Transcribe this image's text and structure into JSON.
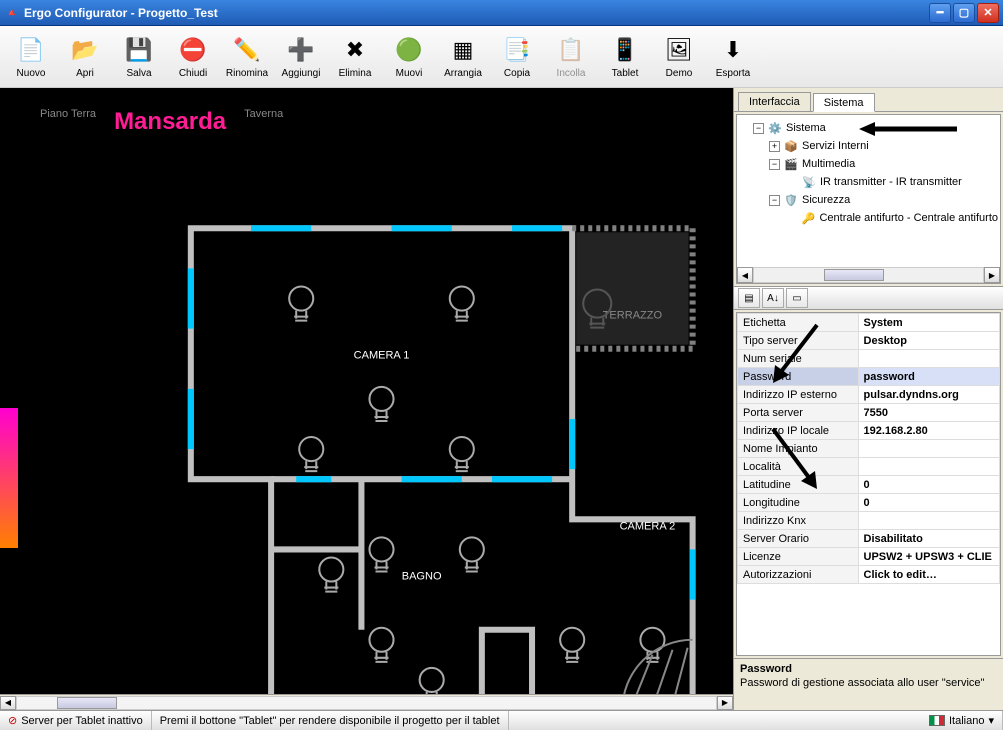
{
  "window": {
    "title": "Ergo Configurator - Progetto_Test"
  },
  "toolbar": [
    {
      "id": "nuovo",
      "label": "Nuovo",
      "icon": "📄",
      "enabled": true
    },
    {
      "id": "apri",
      "label": "Apri",
      "icon": "📂",
      "enabled": true
    },
    {
      "id": "salva",
      "label": "Salva",
      "icon": "💾",
      "enabled": true
    },
    {
      "id": "chiudi",
      "label": "Chiudi",
      "icon": "⛔",
      "enabled": true
    },
    {
      "id": "rinomina",
      "label": "Rinomina",
      "icon": "✏️",
      "enabled": true
    },
    {
      "id": "aggiungi",
      "label": "Aggiungi",
      "icon": "➕",
      "enabled": true
    },
    {
      "id": "elimina",
      "label": "Elimina",
      "icon": "✖",
      "enabled": true
    },
    {
      "id": "muovi",
      "label": "Muovi",
      "icon": "🟢",
      "enabled": true
    },
    {
      "id": "arrangia",
      "label": "Arrangia",
      "icon": "▦",
      "enabled": true
    },
    {
      "id": "copia",
      "label": "Copia",
      "icon": "📑",
      "enabled": true
    },
    {
      "id": "incolla",
      "label": "Incolla",
      "icon": "📋",
      "enabled": false
    },
    {
      "id": "tablet",
      "label": "Tablet",
      "icon": "📱",
      "enabled": true
    },
    {
      "id": "demo",
      "label": "Demo",
      "icon": "🖼",
      "enabled": true
    },
    {
      "id": "esporta",
      "label": "Esporta",
      "icon": "⬇",
      "enabled": true
    }
  ],
  "floors": [
    {
      "label": "Piano Terra",
      "active": false
    },
    {
      "label": "Mansarda",
      "active": true
    },
    {
      "label": "Taverna",
      "active": false
    }
  ],
  "rooms": {
    "camera1": "CAMERA 1",
    "camera2": "CAMERA 2",
    "bagno": "BAGNO",
    "terrazzo": "TERRAZZO"
  },
  "sideTabs": [
    {
      "label": "Interfaccia",
      "active": false
    },
    {
      "label": "Sistema",
      "active": true
    }
  ],
  "tree": {
    "root": {
      "label": "Sistema"
    },
    "servizi": {
      "label": "Servizi Interni"
    },
    "multimedia": {
      "label": "Multimedia"
    },
    "ir": {
      "label": "IR transmitter - IR transmitter"
    },
    "sicurezza": {
      "label": "Sicurezza"
    },
    "centrale": {
      "label": "Centrale antifurto - Centrale antifurto"
    }
  },
  "properties": [
    {
      "name": "Etichetta",
      "value": "System"
    },
    {
      "name": "Tipo server",
      "value": "Desktop"
    },
    {
      "name": "Num seriale",
      "value": ""
    },
    {
      "name": "Password",
      "value": "password",
      "selected": true
    },
    {
      "name": "Indirizzo IP esterno",
      "value": "pulsar.dyndns.org"
    },
    {
      "name": "Porta server",
      "value": "7550"
    },
    {
      "name": "Indirizzo IP locale",
      "value": "192.168.2.80"
    },
    {
      "name": "Nome Impianto",
      "value": ""
    },
    {
      "name": "Località",
      "value": ""
    },
    {
      "name": "Latitudine",
      "value": "0"
    },
    {
      "name": "Longitudine",
      "value": "0"
    },
    {
      "name": "Indirizzo Knx",
      "value": ""
    },
    {
      "name": "Server Orario",
      "value": "Disabilitato"
    },
    {
      "name": "Licenze",
      "value": "UPSW2 + UPSW3 + CLIE"
    },
    {
      "name": "Autorizzazioni",
      "value": "Click to edit…"
    }
  ],
  "propHelp": {
    "title": "Password",
    "desc": "Password di gestione associata allo user \"service\""
  },
  "status": {
    "server": "Server per Tablet inattivo",
    "hint": "Premi il bottone \"Tablet\" per rendere disponibile il progetto per il tablet",
    "lang": "Italiano"
  }
}
